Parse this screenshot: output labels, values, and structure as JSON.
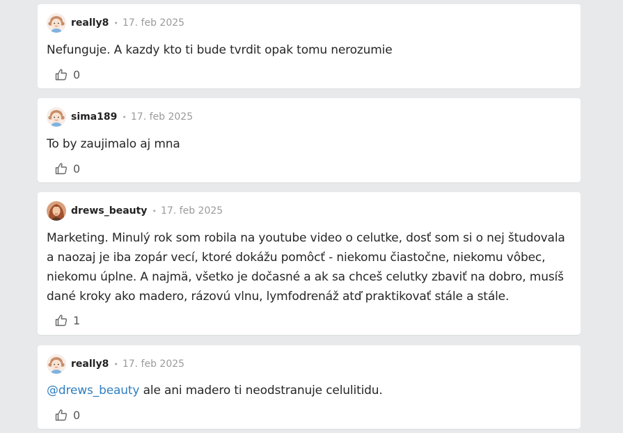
{
  "comments": [
    {
      "username": "really8",
      "separator": "•",
      "date": "17. feb 2025",
      "avatar_icon": "girl-cartoon-avatar-icon",
      "text": "Nefunguje. A kazdy kto ti bude tvrdit opak tomu nerozumie",
      "mention": "",
      "likes": "0"
    },
    {
      "username": "sima189",
      "separator": "•",
      "date": "17. feb 2025",
      "avatar_icon": "girl-cartoon-avatar-icon",
      "text": "To by zaujimalo aj mna",
      "mention": "",
      "likes": "0"
    },
    {
      "username": "drews_beauty",
      "separator": "•",
      "date": "17. feb 2025",
      "avatar_icon": "photo-avatar-icon",
      "text": "Marketing. Minulý rok som robila na youtube video o celutke, dosť som si o nej študovala a naozaj je iba zopár vecí, ktoré dokážu pomôcť - niekomu čiastočne, niekomu vôbec, niekomu úplne. A najmä, všetko je dočasné a ak sa chceš celutky zbaviť na dobro, musíš dané kroky ako madero, rázovú vlnu, lymfodrenáž atď praktikovať stále a stále.",
      "mention": "",
      "likes": "1"
    },
    {
      "username": "really8",
      "separator": "•",
      "date": "17. feb 2025",
      "avatar_icon": "girl-cartoon-avatar-icon",
      "text": " ale ani madero ti neodstranuje celulitidu.",
      "mention": "@drews_beauty",
      "likes": "0"
    }
  ],
  "colors": {
    "page_background": "#e8e9eb",
    "card_background": "#ffffff",
    "mention": "#2f7fc1"
  }
}
